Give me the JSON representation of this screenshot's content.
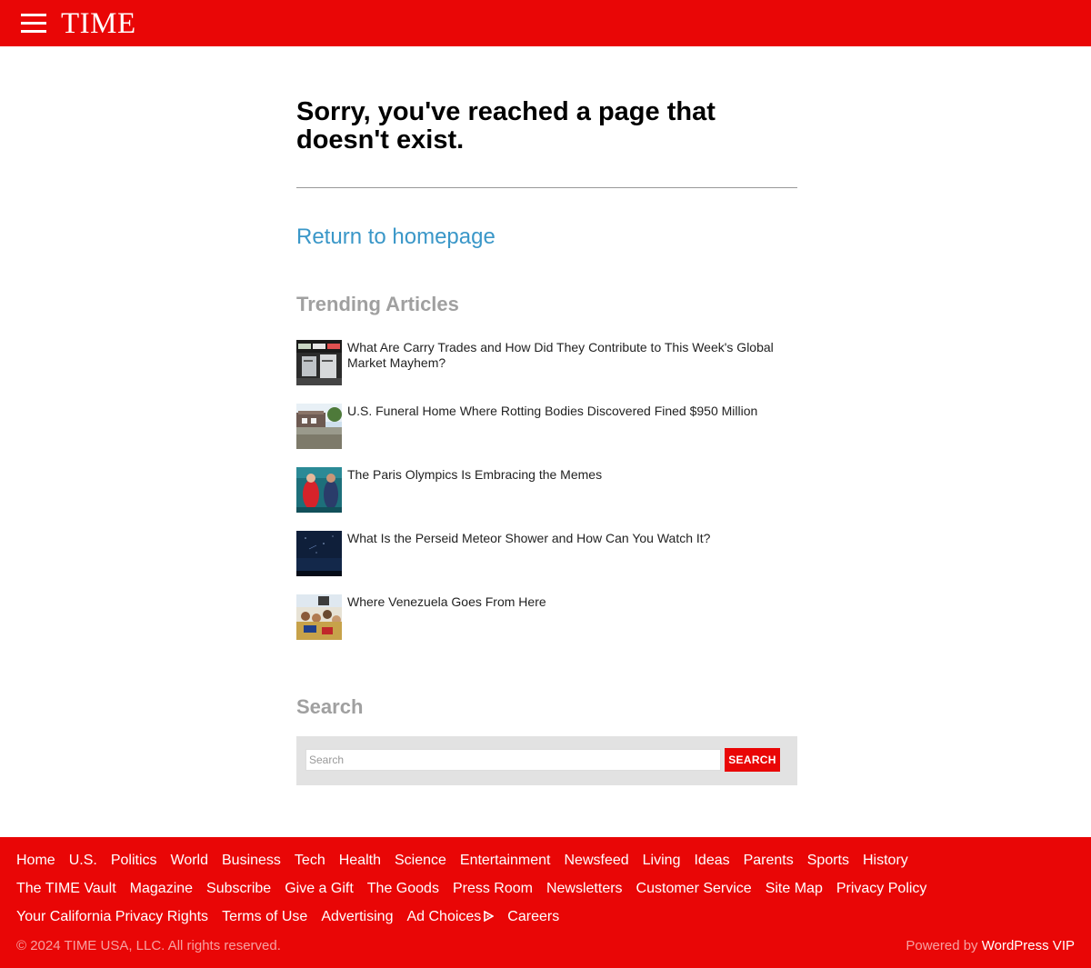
{
  "header": {
    "logo": "TIME",
    "brand_color": "#e90606"
  },
  "main": {
    "headline": "Sorry, you've reached a page that doesn't exist.",
    "return_link": "Return to homepage",
    "trending_title": "Trending Articles",
    "articles": [
      {
        "title": "What Are Carry Trades and How Did They Contribute to This Week's Global Market Mayhem?"
      },
      {
        "title": "U.S. Funeral Home Where Rotting Bodies Discovered Fined $950 Million"
      },
      {
        "title": "The Paris Olympics Is Embracing the Memes"
      },
      {
        "title": "What Is the Perseid Meteor Shower and How Can You Watch It?"
      },
      {
        "title": "Where Venezuela Goes From Here"
      }
    ],
    "search_title": "Search",
    "search_placeholder": "Search",
    "search_button": "SEARCH"
  },
  "footer": {
    "row1": [
      "Home",
      "U.S.",
      "Politics",
      "World",
      "Business",
      "Tech",
      "Health",
      "Science",
      "Entertainment",
      "Newsfeed",
      "Living",
      "Ideas",
      "Parents",
      "Sports",
      "History"
    ],
    "row2": [
      "The TIME Vault",
      "Magazine",
      "Subscribe",
      "Give a Gift",
      "The Goods",
      "Press Room",
      "Newsletters",
      "Customer Service",
      "Site Map",
      "Privacy Policy"
    ],
    "row3": [
      "Your California Privacy Rights",
      "Terms of Use",
      "Advertising",
      "Ad Choices",
      "Careers"
    ],
    "copyright": "© 2024 TIME USA, LLC. All rights reserved.",
    "powered_prefix": "Powered by",
    "powered_brand": "WordPress VIP"
  }
}
